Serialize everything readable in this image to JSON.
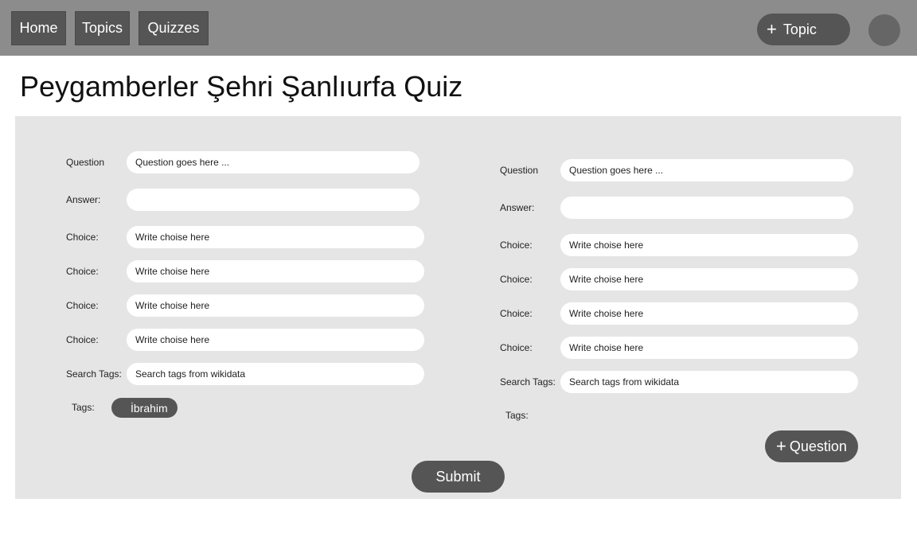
{
  "nav": {
    "items": [
      {
        "label": "Home"
      },
      {
        "label": "Topics"
      },
      {
        "label": "Quizzes"
      }
    ],
    "add_topic_label": "Topic",
    "add_icon": "plus-icon"
  },
  "page": {
    "title": "Peygamberler Şehri Şanlıurfa Quiz"
  },
  "question_forms": [
    {
      "question_label": "Question",
      "question_placeholder": "Question goes here ...",
      "answer_label": "Answer:",
      "answer_value": "",
      "choice_label": "Choice:",
      "choices": [
        "Write choise here",
        "Write choise here",
        "Write choise here",
        "Write choise here"
      ],
      "search_tags_label": "Search Tags:",
      "search_tags_placeholder": "Search tags from wikidata",
      "tags_label": "Tags:",
      "tags": [
        "İbrahim"
      ]
    },
    {
      "question_label": "Question",
      "question_placeholder": "Question goes here ...",
      "answer_label": "Answer:",
      "answer_value": "",
      "choice_label": "Choice:",
      "choices": [
        "Write choise here",
        "Write choise here",
        "Write choise here",
        "Write choise here"
      ],
      "search_tags_label": "Search Tags:",
      "search_tags_placeholder": "Search tags from wikidata",
      "tags_label": "Tags:",
      "tags": []
    }
  ],
  "actions": {
    "add_question_label": "Question",
    "submit_label": "Submit"
  },
  "colors": {
    "topbar": "#8c8c8c",
    "button": "#555555",
    "panel": "#e5e5e5"
  }
}
